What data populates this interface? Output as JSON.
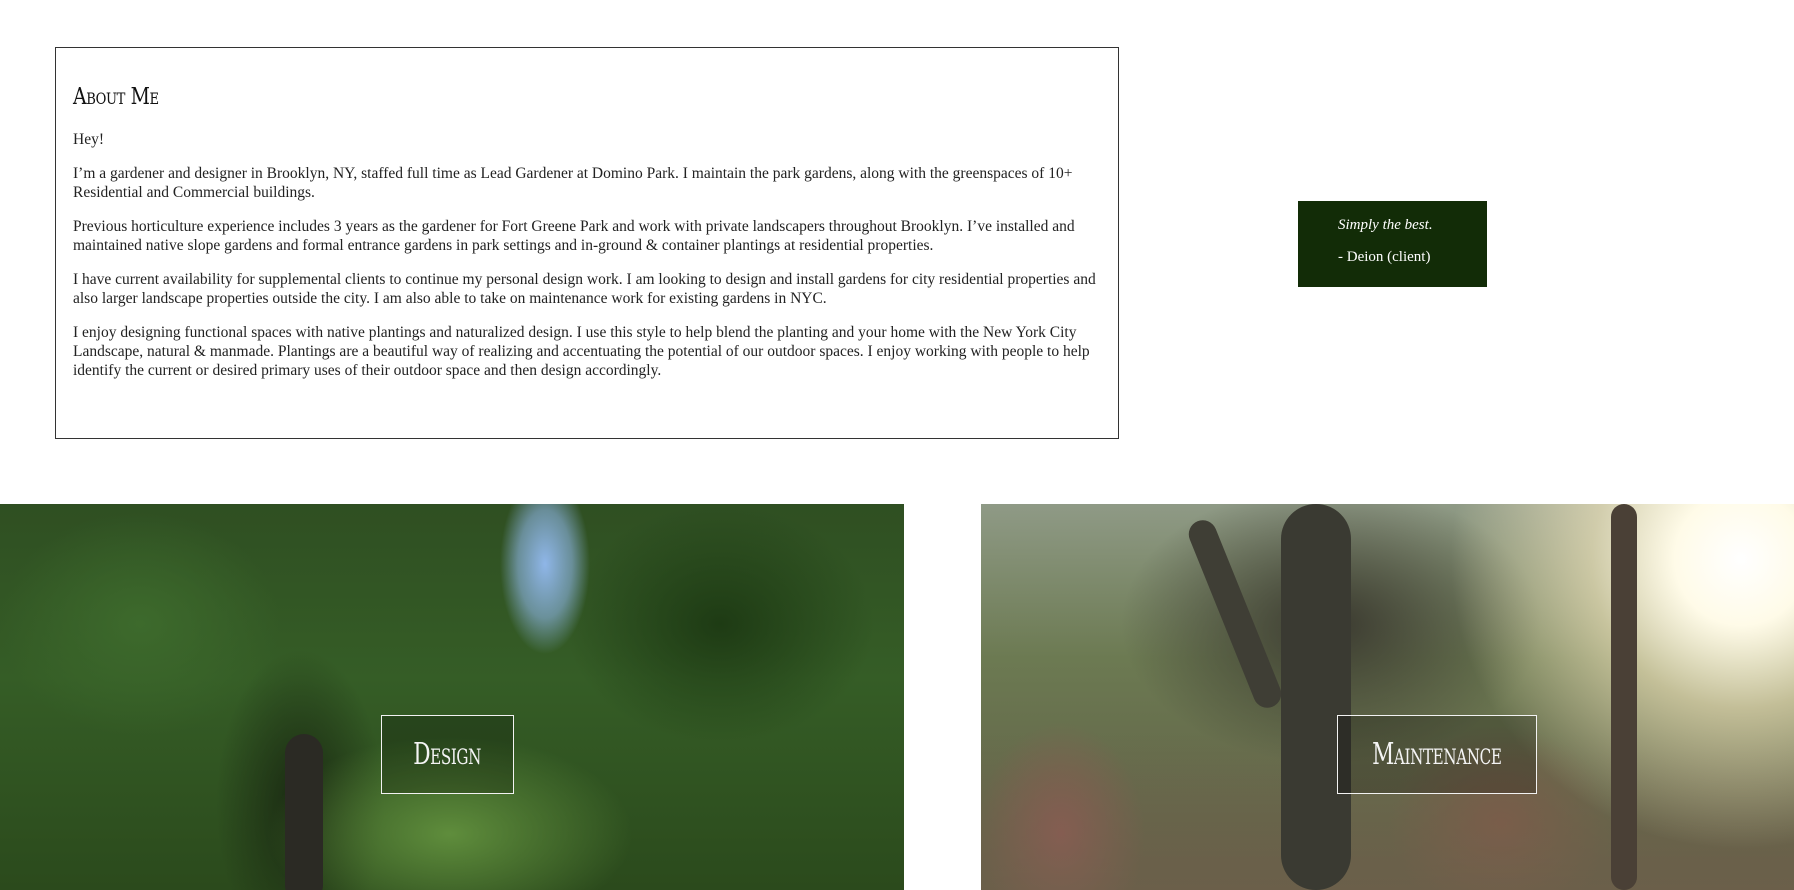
{
  "about": {
    "title": "About Me",
    "paragraphs": [
      "Hey!",
      "I’m a gardener and designer in Brooklyn, NY, staffed full time as Lead Gardener at Domino Park. I maintain the park gardens, along with the greenspaces of 10+ Residential and Commercial buildings.",
      "Previous horticulture experience includes 3 years as the gardener for Fort Greene Park and work with private landscapers throughout Brooklyn. I’ve installed and maintained native slope gardens and formal entrance gardens in park settings and in-ground & container plantings at residential properties.",
      "I have current availability for supplemental clients to continue my personal design work. I am looking to design and install gardens for city residential properties and also larger landscape properties outside the city. I am also able to take on maintenance work for existing gardens in NYC.",
      "I enjoy designing functional spaces with native plantings and naturalized design. I use this style to help blend the planting and your home with the New York City Landscape, natural & manmade. Plantings are a beautiful way of realizing and accentuating the potential of our outdoor spaces. I enjoy working with people to help identify the current or desired primary uses of their outdoor space and then design accordingly."
    ]
  },
  "testimonial": {
    "quote": "Simply the best.",
    "author": "- Deion (client)",
    "background_color": "#122c07"
  },
  "tiles": {
    "design_label": "Design",
    "maintenance_label": "Maintenance"
  }
}
